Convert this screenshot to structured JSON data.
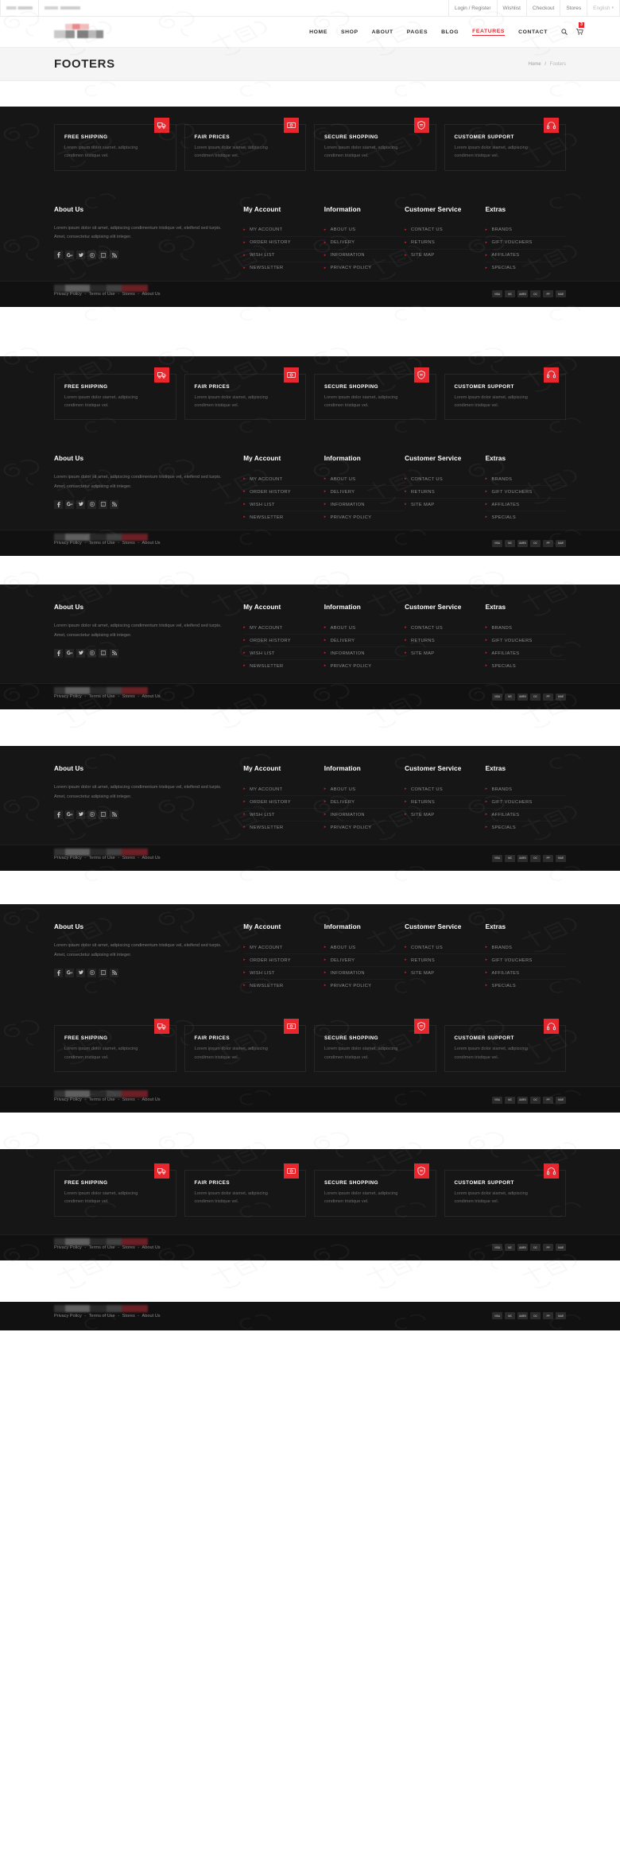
{
  "topbar": {
    "placeholders": [
      "",
      ""
    ],
    "links": [
      "Login / Register",
      "Wishlist",
      "Checkout",
      "Stores"
    ],
    "language": "English",
    "language_caret": "⌄"
  },
  "header": {
    "nav": [
      {
        "label": "HOME",
        "active": false
      },
      {
        "label": "SHOP",
        "active": false
      },
      {
        "label": "ABOUT",
        "active": false
      },
      {
        "label": "PAGES",
        "active": false
      },
      {
        "label": "BLOG",
        "active": false
      },
      {
        "label": "FEATURES",
        "active": true
      },
      {
        "label": "CONTACT",
        "active": false
      }
    ],
    "search_icon": "search-icon",
    "cart_icon": "cart-icon",
    "cart_count": "3"
  },
  "page": {
    "title": "FOOTERS",
    "breadcrumb_home": "Home",
    "breadcrumb_sep": "/",
    "breadcrumb_current": "Footers"
  },
  "services": [
    {
      "title": "FREE SHIPPING",
      "text": "Lorem ipsum dolor siamet, adipiscing condimen tristique vel.",
      "icon": "truck-icon"
    },
    {
      "title": "FAIR PRICES",
      "text": "Lorem ipsum dolor siamet, adipiscing condimen tristique vel.",
      "icon": "money-icon"
    },
    {
      "title": "SECURE SHOPPING",
      "text": "Lorem ipsum dolor siamet, adipiscing condimen tristique vel.",
      "icon": "shield-icon"
    },
    {
      "title": "CUSTOMER SUPPORT",
      "text": "Lorem ipsum dolor siamet, adipiscing condimen tristique vel.",
      "icon": "headphones-icon"
    }
  ],
  "about": {
    "title": "About Us",
    "text": "Lorem ipsum dolor sit amet, adipiscing condimentum tristique vel, eleifend sed turpis. Amet, consectetur adipising elit integer.",
    "socials": [
      "facebook-icon",
      "google-plus-icon",
      "twitter-icon",
      "pinterest-icon",
      "vimeo-icon",
      "rss-icon"
    ]
  },
  "columns": [
    {
      "title": "My Account",
      "items": [
        "MY ACCOUNT",
        "ORDER HISTORY",
        "WISH LIST",
        "NEWSLETTER"
      ]
    },
    {
      "title": "Information",
      "items": [
        "ABOUT US",
        "DELIVERY",
        "INFORMATION",
        "PRIVACY POLICY"
      ]
    },
    {
      "title": "Customer Service",
      "items": [
        "CONTACT US",
        "RETURNS",
        "SITE MAP"
      ]
    },
    {
      "title": "Extras",
      "items": [
        "BRANDS",
        "GIFT VOUCHERS",
        "AFFILIATES",
        "SPECIALS"
      ]
    }
  ],
  "bottombar": {
    "links": [
      "Privacy Policy",
      "Terms of Use",
      "Stores",
      "About Us"
    ],
    "separator": "-",
    "cards": [
      "VISA",
      "MC",
      "AMEX",
      "DC",
      "PP",
      "MAE"
    ]
  },
  "colors": {
    "accent": "#e8262d",
    "footer_bg": "#161616",
    "bottom_bg": "#111111",
    "title_band": "#f5f5f5"
  },
  "bullet": "▸"
}
